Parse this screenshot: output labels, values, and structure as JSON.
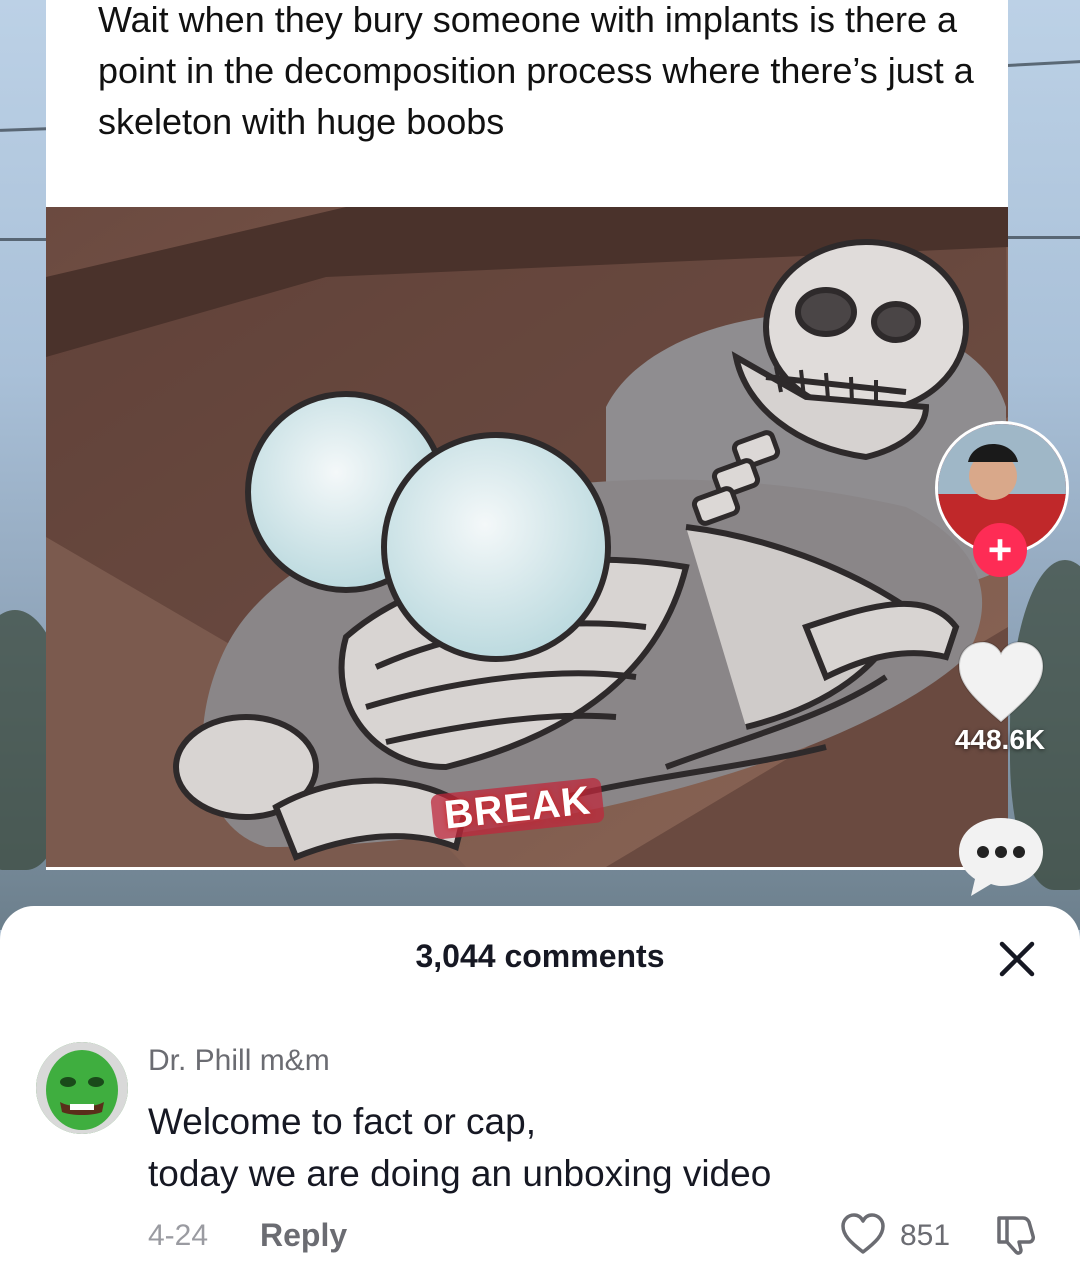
{
  "post": {
    "caption": "Wait when they bury someone with implants is there a point in the decomposition process where there’s just a skeleton with huge boobs",
    "image_overlay_text": "BREAK"
  },
  "rail": {
    "follow_icon": "plus-icon",
    "like_count": "448.6K",
    "comment_icon": "comment-bubble-icon"
  },
  "comments_sheet": {
    "title": "3,044 comments",
    "close_icon": "close-icon",
    "comment": {
      "username": "Dr. Phill m&m",
      "text_line1": "Welcome to fact or cap,",
      "text_line2": "today we are doing an unboxing video",
      "date": "4-24",
      "reply_label": "Reply",
      "like_count": "851"
    }
  },
  "colors": {
    "accent": "#fe2c55",
    "text_primary": "#161823",
    "text_secondary": "#6b6c72"
  }
}
